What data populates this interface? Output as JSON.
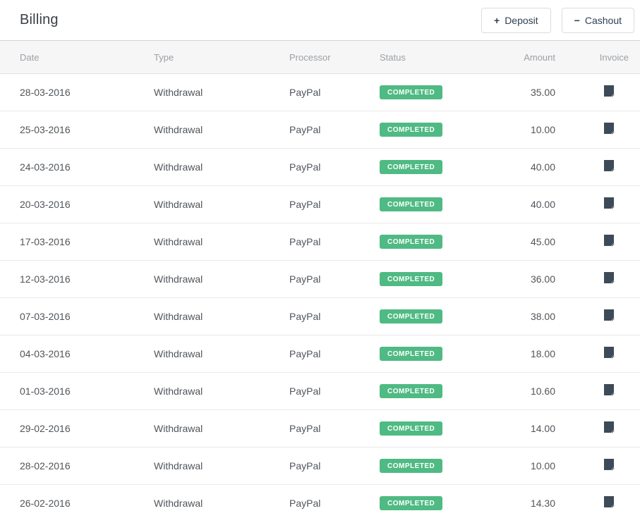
{
  "page": {
    "title": "Billing"
  },
  "toolbar": {
    "deposit": {
      "icon": "+",
      "label": "Deposit"
    },
    "cashout": {
      "icon": "−",
      "label": "Cashout"
    }
  },
  "table": {
    "columns": [
      "Date",
      "Type",
      "Processor",
      "Status",
      "Amount",
      "Invoice"
    ],
    "rows": [
      {
        "date": "28-03-2016",
        "type": "Withdrawal",
        "processor": "PayPal",
        "status": "COMPLETED",
        "amount": "35.00"
      },
      {
        "date": "25-03-2016",
        "type": "Withdrawal",
        "processor": "PayPal",
        "status": "COMPLETED",
        "amount": "10.00"
      },
      {
        "date": "24-03-2016",
        "type": "Withdrawal",
        "processor": "PayPal",
        "status": "COMPLETED",
        "amount": "40.00"
      },
      {
        "date": "20-03-2016",
        "type": "Withdrawal",
        "processor": "PayPal",
        "status": "COMPLETED",
        "amount": "40.00"
      },
      {
        "date": "17-03-2016",
        "type": "Withdrawal",
        "processor": "PayPal",
        "status": "COMPLETED",
        "amount": "45.00"
      },
      {
        "date": "12-03-2016",
        "type": "Withdrawal",
        "processor": "PayPal",
        "status": "COMPLETED",
        "amount": "36.00"
      },
      {
        "date": "07-03-2016",
        "type": "Withdrawal",
        "processor": "PayPal",
        "status": "COMPLETED",
        "amount": "38.00"
      },
      {
        "date": "04-03-2016",
        "type": "Withdrawal",
        "processor": "PayPal",
        "status": "COMPLETED",
        "amount": "18.00"
      },
      {
        "date": "01-03-2016",
        "type": "Withdrawal",
        "processor": "PayPal",
        "status": "COMPLETED",
        "amount": "10.60"
      },
      {
        "date": "29-02-2016",
        "type": "Withdrawal",
        "processor": "PayPal",
        "status": "COMPLETED",
        "amount": "14.00"
      },
      {
        "date": "28-02-2016",
        "type": "Withdrawal",
        "processor": "PayPal",
        "status": "COMPLETED",
        "amount": "10.00"
      },
      {
        "date": "26-02-2016",
        "type": "Withdrawal",
        "processor": "PayPal",
        "status": "COMPLETED",
        "amount": "14.30"
      }
    ]
  },
  "colors": {
    "status_badge_green": "#4fba83",
    "invoice_icon_dark": "#3d4a57",
    "invoice_icon_fold": "#6b7680"
  }
}
